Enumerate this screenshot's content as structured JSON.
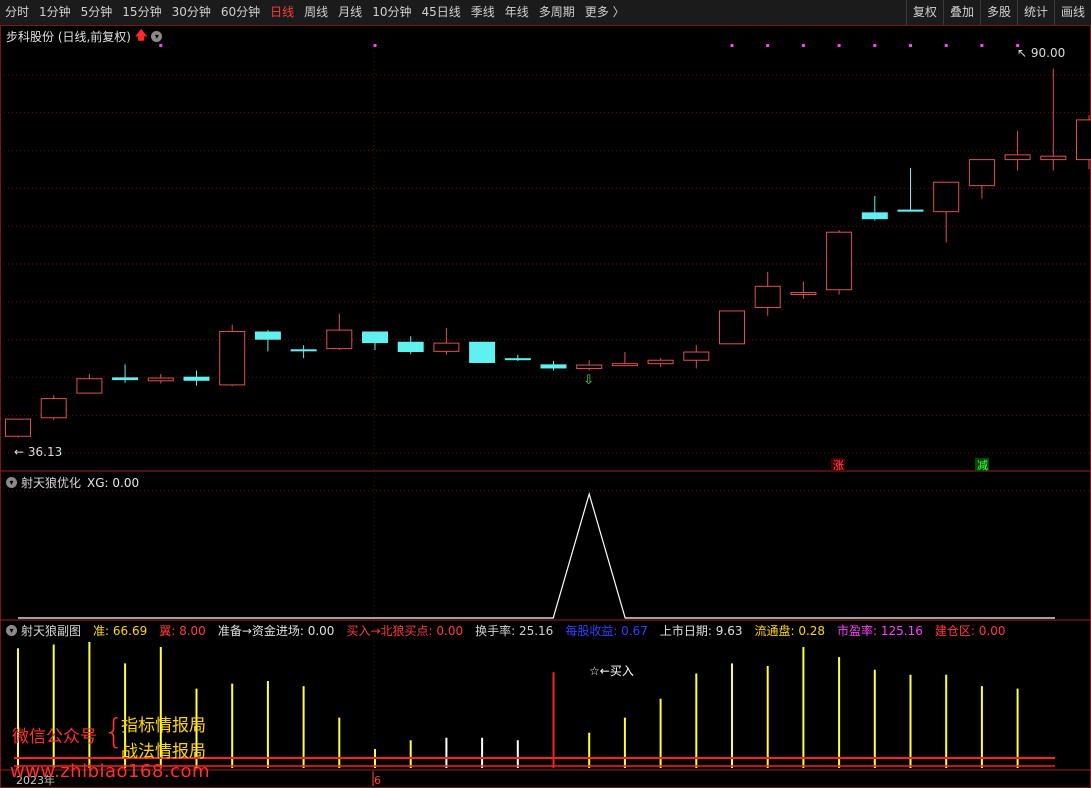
{
  "toolbar": {
    "periods": [
      {
        "label": "分时",
        "active": false
      },
      {
        "label": "1分钟",
        "active": false
      },
      {
        "label": "5分钟",
        "active": false
      },
      {
        "label": "15分钟",
        "active": false
      },
      {
        "label": "30分钟",
        "active": false
      },
      {
        "label": "60分钟",
        "active": false
      },
      {
        "label": "日线",
        "active": true
      },
      {
        "label": "周线",
        "active": false
      },
      {
        "label": "月线",
        "active": false
      },
      {
        "label": "10分钟",
        "active": false
      },
      {
        "label": "45日线",
        "active": false
      },
      {
        "label": "季线",
        "active": false
      },
      {
        "label": "年线",
        "active": false
      },
      {
        "label": "多周期",
        "active": false
      },
      {
        "label": "更多 〉",
        "active": false
      }
    ],
    "right_buttons": [
      "复权",
      "叠加",
      "多股",
      "统计",
      "画线"
    ]
  },
  "main_panel": {
    "title": "步科股份 (日线,前复权)",
    "high_label": "90.00",
    "low_label": "36.13",
    "zhang_badge": "涨",
    "jian_badge": "减"
  },
  "indicator1": {
    "title": "射天狼优化",
    "xg": "XG: 0.00"
  },
  "indicator2": {
    "title": "射天狼副图",
    "items": [
      {
        "text": "准: 66.69",
        "color": "#ffd700"
      },
      {
        "text": "翼: 8.00",
        "color": "#ff3c3c"
      },
      {
        "text": "准备→资金进场: 0.00",
        "color": "#e0e0e0"
      },
      {
        "text": "买入→北狼买点: 0.00",
        "color": "#ff3c3c"
      },
      {
        "text": "换手率: 25.16",
        "color": "#d0d0d0"
      },
      {
        "text": "每股收益: 0.67",
        "color": "#3040ff"
      },
      {
        "text": "上市日期: 9.63",
        "color": "#e0e0e0"
      },
      {
        "text": "流通盘: 0.28",
        "color": "#ffd700"
      },
      {
        "text": "市盈率: 125.16",
        "color": "#ff40ff"
      },
      {
        "text": "建仓区: 0.00",
        "color": "#ff3c3c"
      }
    ],
    "buy_label": "☆←买入"
  },
  "axis": {
    "year_label": "2023年",
    "month_label": "6"
  },
  "watermark": {
    "line1": "微信公众号",
    "line2": "指标情报局",
    "line3": "战法情报局",
    "url": "www.zhibiao168.com"
  },
  "chart_data": {
    "type": "candlestick",
    "ylim": [
      34,
      93
    ],
    "candles": [
      {
        "o": 36.3,
        "h": 38.8,
        "l": 36.1,
        "c": 38.8,
        "color": "red"
      },
      {
        "o": 39.0,
        "h": 42.3,
        "l": 38.7,
        "c": 41.8,
        "color": "red"
      },
      {
        "o": 42.6,
        "h": 45.4,
        "l": 42.6,
        "c": 44.7,
        "color": "red"
      },
      {
        "o": 44.9,
        "h": 46.8,
        "l": 44.1,
        "c": 44.5,
        "color": "cyan"
      },
      {
        "o": 44.4,
        "h": 45.4,
        "l": 44.0,
        "c": 44.8,
        "color": "red"
      },
      {
        "o": 45.0,
        "h": 45.9,
        "l": 43.7,
        "c": 44.4,
        "color": "cyan"
      },
      {
        "o": 43.8,
        "h": 52.6,
        "l": 43.6,
        "c": 51.6,
        "color": "red"
      },
      {
        "o": 51.6,
        "h": 51.8,
        "l": 48.7,
        "c": 50.4,
        "color": "cyan"
      },
      {
        "o": 49.0,
        "h": 49.6,
        "l": 47.7,
        "c": 48.7,
        "color": "cyan"
      },
      {
        "o": 49.1,
        "h": 54.2,
        "l": 48.9,
        "c": 51.8,
        "color": "red"
      },
      {
        "o": 51.6,
        "h": 51.6,
        "l": 48.9,
        "c": 49.9,
        "color": "cyan"
      },
      {
        "o": 50.1,
        "h": 50.9,
        "l": 48.3,
        "c": 48.6,
        "color": "cyan"
      },
      {
        "o": 48.7,
        "h": 52.1,
        "l": 48.2,
        "c": 49.9,
        "color": "red"
      },
      {
        "o": 50.1,
        "h": 50.1,
        "l": 47.0,
        "c": 47.0,
        "color": "cyan"
      },
      {
        "o": 47.7,
        "h": 48.2,
        "l": 47.3,
        "c": 47.7,
        "color": "cyan"
      },
      {
        "o": 46.8,
        "h": 47.3,
        "l": 45.9,
        "c": 46.2,
        "color": "cyan"
      },
      {
        "o": 46.2,
        "h": 47.4,
        "l": 45.9,
        "c": 46.7,
        "color": "red"
      },
      {
        "o": 46.9,
        "h": 48.6,
        "l": 46.7,
        "c": 46.9,
        "color": "red"
      },
      {
        "o": 46.9,
        "h": 47.7,
        "l": 46.4,
        "c": 47.4,
        "color": "red"
      },
      {
        "o": 47.4,
        "h": 49.6,
        "l": 46.2,
        "c": 48.6,
        "color": "red"
      },
      {
        "o": 49.8,
        "h": 54.6,
        "l": 49.8,
        "c": 54.6,
        "color": "red"
      },
      {
        "o": 55.1,
        "h": 60.3,
        "l": 53.9,
        "c": 58.2,
        "color": "red"
      },
      {
        "o": 57.0,
        "h": 58.9,
        "l": 56.4,
        "c": 57.3,
        "color": "red"
      },
      {
        "o": 57.7,
        "h": 66.4,
        "l": 57.0,
        "c": 66.1,
        "color": "red"
      },
      {
        "o": 69.0,
        "h": 71.4,
        "l": 67.8,
        "c": 68.0,
        "color": "cyan"
      },
      {
        "o": 69.4,
        "h": 75.5,
        "l": 69.1,
        "c": 69.1,
        "color": "cyan"
      },
      {
        "o": 69.1,
        "h": 73.4,
        "l": 64.6,
        "c": 73.4,
        "color": "red"
      },
      {
        "o": 72.9,
        "h": 75.3,
        "l": 71.0,
        "c": 76.7,
        "color": "red"
      },
      {
        "o": 76.7,
        "h": 80.9,
        "l": 75.1,
        "c": 77.4,
        "color": "red"
      },
      {
        "o": 77.2,
        "h": 90.0,
        "l": 75.1,
        "c": 76.7,
        "color": "red"
      },
      {
        "o": 76.7,
        "h": 83.2,
        "l": 75.3,
        "c": 82.5,
        "color": "red"
      }
    ],
    "top_dots_index": [
      4,
      10,
      20,
      21,
      22,
      23,
      24,
      25,
      26,
      27,
      28
    ],
    "down_arrow_index": 16,
    "xg_peak_index": 16,
    "subbars": [
      {
        "v": 0.95,
        "color": "yellow"
      },
      {
        "v": 0.98,
        "color": "yellow"
      },
      {
        "v": 1.0,
        "color": "yellow"
      },
      {
        "v": 0.83,
        "color": "yellow"
      },
      {
        "v": 0.96,
        "color": "yellow"
      },
      {
        "v": 0.63,
        "color": "yellow"
      },
      {
        "v": 0.67,
        "color": "yellow"
      },
      {
        "v": 0.69,
        "color": "yellow"
      },
      {
        "v": 0.65,
        "color": "yellow"
      },
      {
        "v": 0.4,
        "color": "yellow"
      },
      {
        "v": 0.15,
        "color": "yellow"
      },
      {
        "v": 0.22,
        "color": "yellow"
      },
      {
        "v": 0.24,
        "color": "white"
      },
      {
        "v": 0.24,
        "color": "white"
      },
      {
        "v": 0.22,
        "color": "white"
      },
      {
        "v": 0.76,
        "color": "red"
      },
      {
        "v": 0.28,
        "color": "yellow"
      },
      {
        "v": 0.4,
        "color": "yellow"
      },
      {
        "v": 0.55,
        "color": "yellow"
      },
      {
        "v": 0.75,
        "color": "yellow"
      },
      {
        "v": 0.83,
        "color": "yellow"
      },
      {
        "v": 0.81,
        "color": "yellow"
      },
      {
        "v": 0.96,
        "color": "yellow"
      },
      {
        "v": 0.88,
        "color": "yellow"
      },
      {
        "v": 0.78,
        "color": "yellow"
      },
      {
        "v": 0.74,
        "color": "yellow"
      },
      {
        "v": 0.74,
        "color": "yellow"
      },
      {
        "v": 0.65,
        "color": "yellow"
      },
      {
        "v": 0.63,
        "color": "yellow"
      }
    ]
  },
  "colors": {
    "up": "#e05050",
    "down": "#60f0f0",
    "grid": "#6a1010",
    "dot": "#ff40ff",
    "accent": "#ff3c3c"
  }
}
